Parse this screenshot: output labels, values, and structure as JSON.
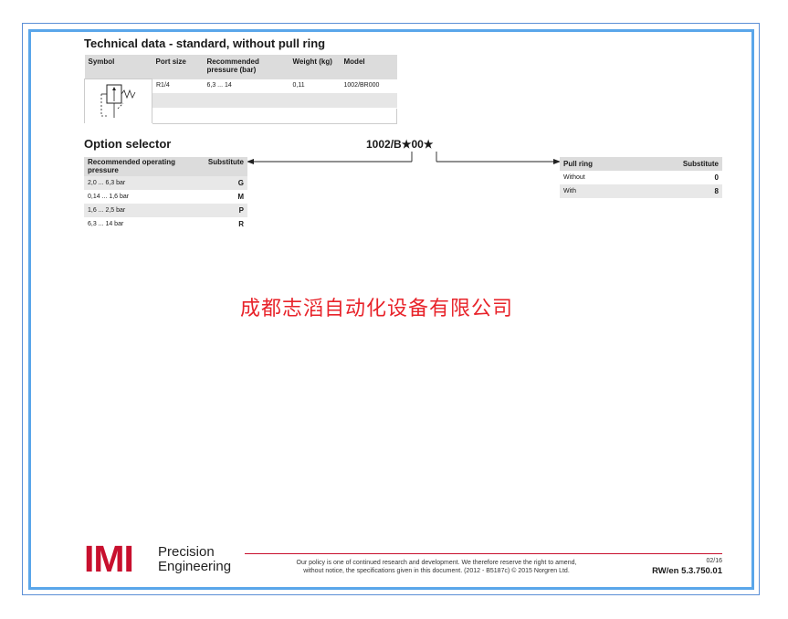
{
  "tech": {
    "title": "Technical data - standard, without pull ring",
    "headers": [
      "Symbol",
      "Port size",
      "Recommended pressure (bar)",
      "Weight (kg)",
      "Model"
    ],
    "row": {
      "port": "R1/4",
      "pressure": "6,3 ... 14",
      "weight": "0,11",
      "model": "1002/BR000"
    }
  },
  "option": {
    "title": "Option selector",
    "model_code": "1002/B★00★",
    "left_headers": [
      "Recommended operating pressure",
      "Substitute"
    ],
    "left_rows": [
      {
        "label": "2,0 ... 6,3 bar",
        "code": "G"
      },
      {
        "label": "0,14 ... 1,6 bar",
        "code": "M"
      },
      {
        "label": "1,6 ... 2,5 bar",
        "code": "P"
      },
      {
        "label": "6,3 ... 14 bar",
        "code": "R"
      }
    ],
    "right_headers": [
      "Pull ring",
      "Substitute"
    ],
    "right_rows": [
      {
        "label": "Without",
        "code": "0"
      },
      {
        "label": "With",
        "code": "8"
      }
    ]
  },
  "watermark": "成都志滔自动化设备有限公司",
  "footer": {
    "logo_text": "IMI",
    "logo_line1": "Precision",
    "logo_line2": "Engineering",
    "policy_line1": "Our policy is one of continued research and development. We therefore reserve the right to amend,",
    "policy_line2": "without notice, the specifications given in this document. (2012 - B5187c) © 2015 Norgren Ltd.",
    "page": "02/16",
    "doc_ref": "RW/en 5.3.750.01"
  },
  "colors": {
    "frame": "#5aa6ea",
    "brand": "#c8102e",
    "watermark": "#e8232a"
  }
}
